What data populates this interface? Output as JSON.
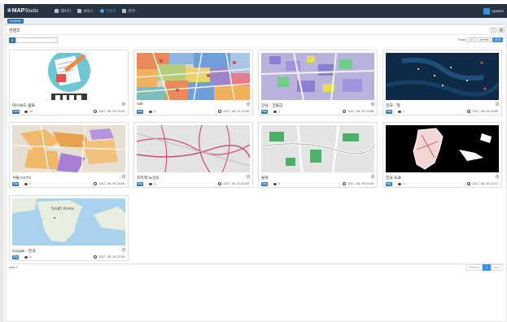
{
  "app": {
    "logo_text": "MAP",
    "logo_sub": "Studio",
    "user": "system"
  },
  "nav": [
    {
      "label": "데이터",
      "icon": "database-icon"
    },
    {
      "label": "서비스",
      "icon": "globe-icon"
    },
    {
      "label": "컨텐츠",
      "icon": "contents-icon",
      "active": true
    },
    {
      "label": "관리",
      "icon": "tools-icon"
    }
  ],
  "subbar": {
    "tab_label": "contents"
  },
  "page": {
    "title": "컨텐츠"
  },
  "toolbar": {
    "search_placeholder": "",
    "show_label": "Show",
    "show_value": "12",
    "sort_value": "ymmd",
    "new_label": "신규"
  },
  "cards": [
    {
      "title": "대시보드 샘플",
      "badge": "Dash",
      "views": "10",
      "date": "2017. 08. 28 20:28",
      "thumb": "blog"
    },
    {
      "title": "null",
      "badge": "Map",
      "views": "0",
      "date": "2017. 08. 25 19:46",
      "thumb": "zoning"
    },
    {
      "title": "강남 - 건물군",
      "badge": "Map",
      "views": "1",
      "date": "2017. 08. 25 19:58",
      "thumb": "gangnam"
    },
    {
      "title": "전국 - 청",
      "badge": "Map",
      "views": "1",
      "date": "2017. 08. 25 19:50",
      "thumb": "dark"
    },
    {
      "title": "서울 CCTV",
      "badge": "Map",
      "views": "1",
      "date": "2017. 08. 25 19:48",
      "thumb": "cctv"
    },
    {
      "title": "지하철 노선도",
      "badge": "Map",
      "views": "1",
      "date": "2017. 08. 25 19:43",
      "thumb": "subway"
    },
    {
      "title": "블럭",
      "badge": "Map",
      "views": "0",
      "date": "2017. 08. 25 19:40",
      "thumb": "block"
    },
    {
      "title": "한국 도로",
      "badge": "Map",
      "views": "1",
      "date": "2017. 08. 25 19:37",
      "thumb": "korea"
    },
    {
      "title": "Google - 한국",
      "badge": "Map",
      "views": "3",
      "date": "2017. 08. 25 19:35",
      "thumb": "google",
      "map_label": "South Korea"
    }
  ],
  "footer": {
    "total": "total 9",
    "previous": "Previous",
    "page": "1",
    "next": "Next"
  },
  "colors": {
    "navbar": "#263341",
    "accent": "#3a8ee6",
    "badge": "#3276b1"
  }
}
